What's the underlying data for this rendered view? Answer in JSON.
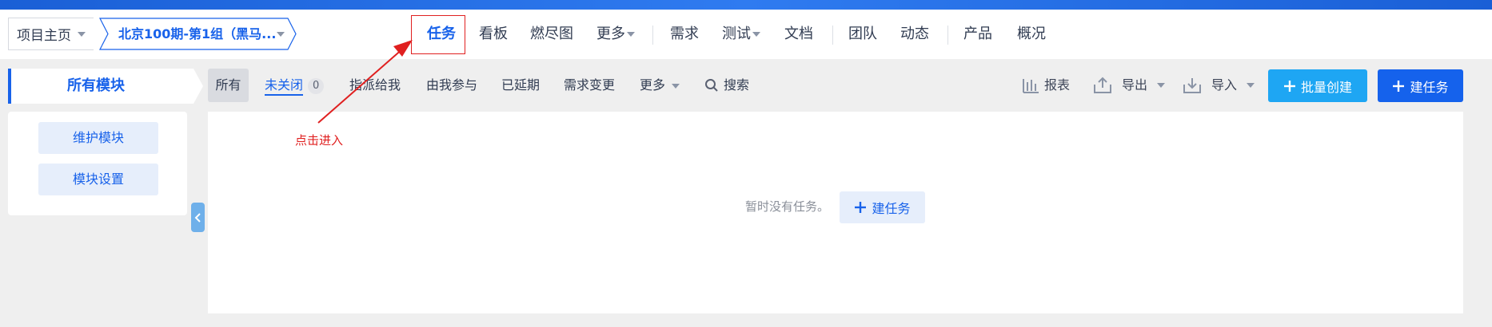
{
  "breadcrumb": {
    "home": "项目主页",
    "project": "北京100期-第1组（黑马..."
  },
  "nav": {
    "items": [
      "任务",
      "看板",
      "燃尽图",
      "更多",
      "需求",
      "测试",
      "文档",
      "团队",
      "动态",
      "产品",
      "概况"
    ],
    "active": "任务"
  },
  "sidebar": {
    "title": "所有模块",
    "buttons": [
      "维护模块",
      "模块设置"
    ]
  },
  "filters": {
    "all": "所有",
    "open": "未关闭",
    "open_count": "0",
    "assigned": "指派给我",
    "participated": "由我参与",
    "delayed": "已延期",
    "changed": "需求变更",
    "more": "更多",
    "search": "搜索"
  },
  "toolbar": {
    "report": "报表",
    "export": "导出",
    "import": "导入",
    "batch_create": "批量创建",
    "create_task": "建任务"
  },
  "main": {
    "empty_text": "暂时没有任务。",
    "empty_button": "建任务"
  },
  "annotation": {
    "text": "点击进入",
    "color": "#e02020"
  },
  "colors": {
    "accent": "#1862ea",
    "batch_button": "#1ea6f3",
    "primary_button": "#1562ec"
  }
}
